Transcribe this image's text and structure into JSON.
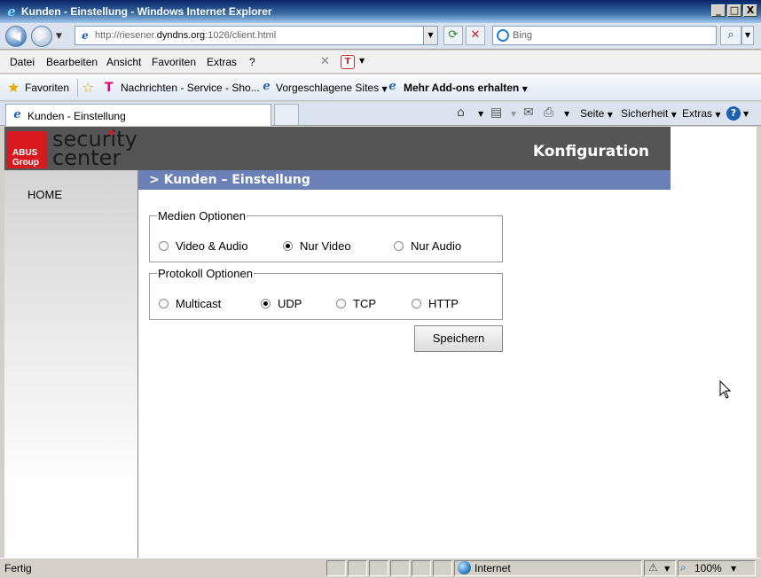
{
  "window": {
    "title": "Kunden - Einstellung - Windows Internet Explorer",
    "minimize": "_",
    "maximize": "□",
    "close": "X"
  },
  "address": {
    "url_prefix": "http://riesener.",
    "url_domain": "dyndns.org",
    "url_suffix": ":1026/client.html",
    "search_placeholder": "Bing"
  },
  "menu": {
    "items": [
      "Datei",
      "Bearbeiten",
      "Ansicht",
      "Favoriten",
      "Extras",
      "?"
    ]
  },
  "favorites": {
    "favorites_label": "Favoriten",
    "items": [
      "Nachrichten - Service - Sho...",
      "Vorgeschlagene Sites",
      "Mehr Add-ons erhalten"
    ]
  },
  "tabs": {
    "active_label": "Kunden - Einstellung"
  },
  "commandbar": {
    "page": "Seite",
    "safety": "Sicherheit",
    "tools": "Extras"
  },
  "page": {
    "logo_brand": "ABUS Group",
    "logo_line1": "security",
    "logo_line2": "center",
    "header_title": "Konfiguration",
    "nav_home": "HOME",
    "section_title": "> Kunden – Einstellung",
    "media": {
      "legend": "Medien Optionen",
      "options": [
        "Video & Audio",
        "Nur Video",
        "Nur Audio"
      ],
      "selected": "Nur Video"
    },
    "protocol": {
      "legend": "Protokoll Optionen",
      "options": [
        "Multicast",
        "UDP",
        "TCP",
        "HTTP"
      ],
      "selected": "UDP"
    },
    "save_label": "Speichern"
  },
  "status": {
    "text": "Fertig",
    "zone": "Internet",
    "zoom": "100%"
  }
}
